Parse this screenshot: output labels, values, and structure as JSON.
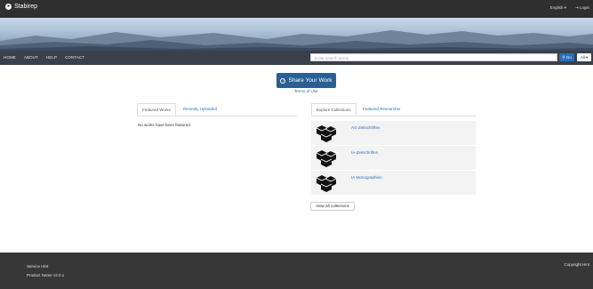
{
  "topbar": {
    "brand": "Stabirep",
    "language": "English ▾",
    "login": "Login"
  },
  "nav": {
    "links": [
      "HOME",
      "ABOUT",
      "HELP",
      "CONTACT"
    ]
  },
  "search": {
    "placeholder": "Enter search terms",
    "go_label": "Go",
    "scope_label": "All ▾"
  },
  "share": {
    "button_label": "Share Your Work",
    "terms_link": "Terms of Use"
  },
  "left_tabs": {
    "featured_works": "Featured Works",
    "recently_uploaded": "Recently Uploaded",
    "empty_message": "No works have been featured"
  },
  "right_tabs": {
    "explore_collections": "Explore Collections",
    "featured_researcher": "Featured Researcher"
  },
  "collections": [
    {
      "title": "AG-Zeitschriften",
      "icon": "cubes-icon"
    },
    {
      "title": "IA-Zeitschriften",
      "icon": "cubes-icon"
    },
    {
      "title": "IA-Monographien",
      "icon": "cubes-icon"
    }
  ],
  "view_all_label": "View all collections",
  "footer": {
    "service_line": "Service Hint",
    "product_line": "Product Name v2.0.1",
    "copyright": "Copyright Hint"
  },
  "colors": {
    "topbar": "#2f2f2f",
    "navbar": "#28303e",
    "primary": "#2a5f93",
    "link": "#2a6ebb",
    "footer": "#373737"
  }
}
